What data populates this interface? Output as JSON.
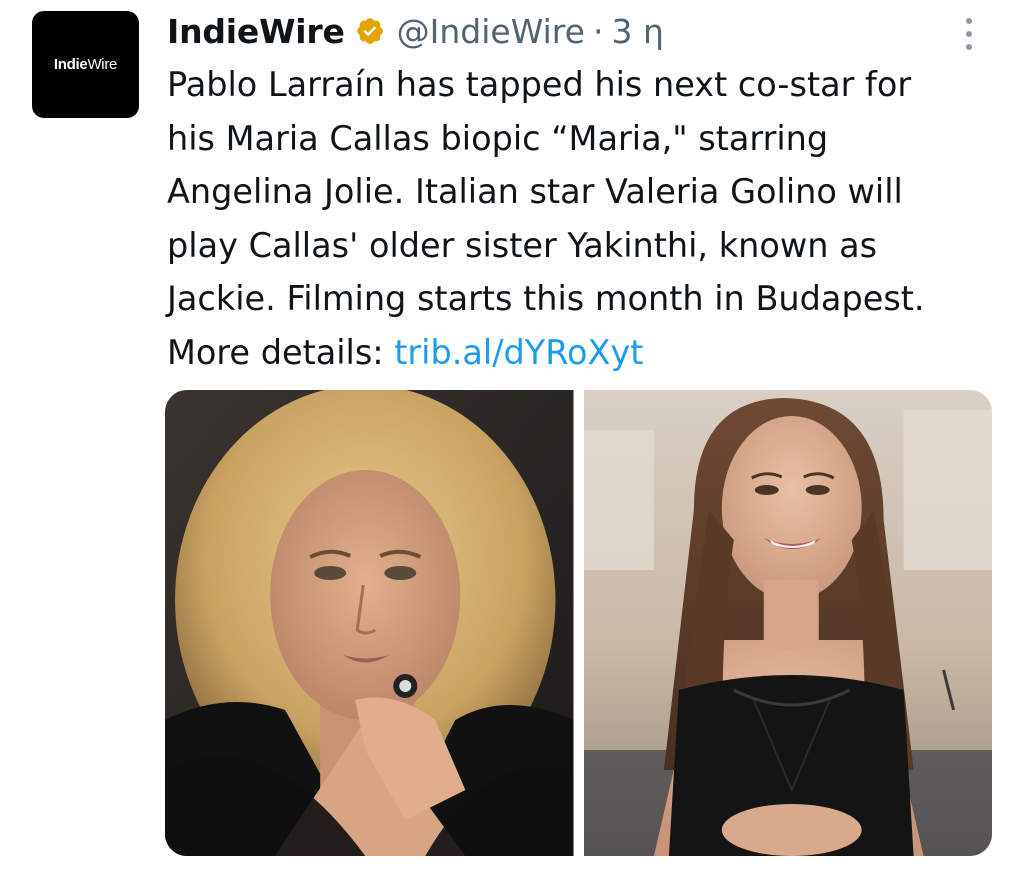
{
  "tweet": {
    "author": {
      "display_name": "IndieWire",
      "handle": "@IndieWire",
      "avatar_logo": {
        "bold_part": "Indie",
        "light_part": "Wire"
      },
      "verified": true,
      "verified_color": "#f4b400"
    },
    "separator": "·",
    "time": "3 η",
    "more_icon": "vertical-ellipsis-icon",
    "text_lines": [
      "Pablo Larraín has tapped his next co-star for",
      "his Maria Callas biopic “Maria,\" starring",
      "Angelina Jolie. Italian star Valeria Golino will",
      "play Callas' older sister Yakinthi, known as",
      "Jackie. Filming starts this month in Budapest."
    ],
    "details_prefix": "More details: ",
    "link_text": "trib.al/dYRoXyt",
    "link_color": "#1d9bf0",
    "media": [
      {
        "subject": "portrait of woman with curly blonde hair and ring"
      },
      {
        "subject": "portrait of smiling woman with long brown hair in black dress"
      }
    ]
  }
}
